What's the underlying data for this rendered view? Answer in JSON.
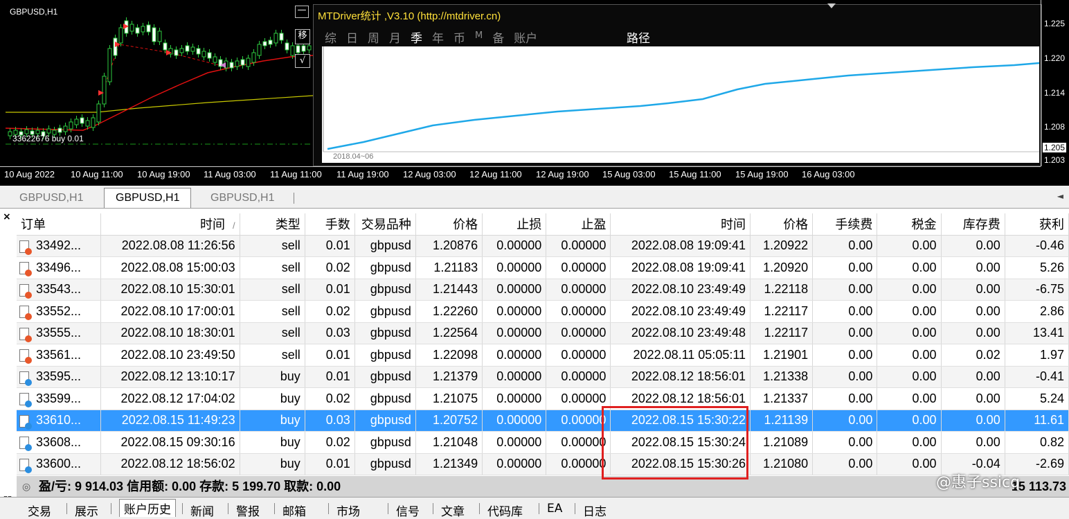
{
  "mini_chart": {
    "title": "GBPUSD,H1",
    "order_label": "33622676 buy 0.01",
    "move_button": "移",
    "check_button": "√",
    "minus_button": "—"
  },
  "panel": {
    "title": "MTDriver统计 ,V3.10 (http://mtdriver.cn)",
    "tabs": [
      "综",
      "日",
      "周",
      "月",
      "季",
      "年",
      "币",
      "M",
      "备",
      "账户"
    ],
    "active_tab": "季",
    "route_tab": "路径",
    "start_date": "2018.04~06",
    "line_color": "#1fa8e8"
  },
  "price_axis": [
    "1.225",
    "1.220",
    "1.214",
    "1.208",
    "1.205",
    "1.203"
  ],
  "time_axis": [
    "10 Aug 2022",
    "10 Aug 11:00",
    "10 Aug 19:00",
    "11 Aug 03:00",
    "11 Aug 11:00",
    "11 Aug 19:00",
    "12 Aug 03:00",
    "12 Aug 11:00",
    "12 Aug 19:00",
    "15 Aug 03:00",
    "15 Aug 11:00",
    "15 Aug 19:00",
    "16 Aug 03:00"
  ],
  "chart_tabs": [
    "GBPUSD,H1",
    "GBPUSD,H1",
    "GBPUSD,H1"
  ],
  "chart_tab_scroll": "◄",
  "close_icon": "×",
  "table": {
    "headers": [
      "订单",
      "时间",
      "类型",
      "手数",
      "交易品种",
      "价格",
      "止损",
      "止盈",
      "时间",
      "价格",
      "手续费",
      "税金",
      "库存费",
      "获利"
    ],
    "sort_marker": "/",
    "rows": [
      {
        "icon": "sell",
        "order": "33492...",
        "open_time": "2022.08.08 11:26:56",
        "type": "sell",
        "lots": "0.01",
        "symbol": "gbpusd",
        "open_price": "1.20876",
        "sl": "0.00000",
        "tp": "0.00000",
        "close_time": "2022.08.08 19:09:41",
        "close_price": "1.20922",
        "commission": "0.00",
        "taxes": "0.00",
        "swap": "0.00",
        "profit": "-0.46"
      },
      {
        "icon": "sell",
        "order": "33496...",
        "open_time": "2022.08.08 15:00:03",
        "type": "sell",
        "lots": "0.02",
        "symbol": "gbpusd",
        "open_price": "1.21183",
        "sl": "0.00000",
        "tp": "0.00000",
        "close_time": "2022.08.08 19:09:41",
        "close_price": "1.20920",
        "commission": "0.00",
        "taxes": "0.00",
        "swap": "0.00",
        "profit": "5.26"
      },
      {
        "icon": "sell",
        "order": "33543...",
        "open_time": "2022.08.10 15:30:01",
        "type": "sell",
        "lots": "0.01",
        "symbol": "gbpusd",
        "open_price": "1.21443",
        "sl": "0.00000",
        "tp": "0.00000",
        "close_time": "2022.08.10 23:49:49",
        "close_price": "1.22118",
        "commission": "0.00",
        "taxes": "0.00",
        "swap": "0.00",
        "profit": "-6.75"
      },
      {
        "icon": "sell",
        "order": "33552...",
        "open_time": "2022.08.10 17:00:01",
        "type": "sell",
        "lots": "0.02",
        "symbol": "gbpusd",
        "open_price": "1.22260",
        "sl": "0.00000",
        "tp": "0.00000",
        "close_time": "2022.08.10 23:49:49",
        "close_price": "1.22117",
        "commission": "0.00",
        "taxes": "0.00",
        "swap": "0.00",
        "profit": "2.86"
      },
      {
        "icon": "sell",
        "order": "33555...",
        "open_time": "2022.08.10 18:30:01",
        "type": "sell",
        "lots": "0.03",
        "symbol": "gbpusd",
        "open_price": "1.22564",
        "sl": "0.00000",
        "tp": "0.00000",
        "close_time": "2022.08.10 23:49:48",
        "close_price": "1.22117",
        "commission": "0.00",
        "taxes": "0.00",
        "swap": "0.00",
        "profit": "13.41"
      },
      {
        "icon": "sell",
        "order": "33561...",
        "open_time": "2022.08.10 23:49:50",
        "type": "sell",
        "lots": "0.01",
        "symbol": "gbpusd",
        "open_price": "1.22098",
        "sl": "0.00000",
        "tp": "0.00000",
        "close_time": "2022.08.11 05:05:11",
        "close_price": "1.21901",
        "commission": "0.00",
        "taxes": "0.00",
        "swap": "0.02",
        "profit": "1.97"
      },
      {
        "icon": "buy",
        "order": "33595...",
        "open_time": "2022.08.12 13:10:17",
        "type": "buy",
        "lots": "0.01",
        "symbol": "gbpusd",
        "open_price": "1.21379",
        "sl": "0.00000",
        "tp": "0.00000",
        "close_time": "2022.08.12 18:56:01",
        "close_price": "1.21338",
        "commission": "0.00",
        "taxes": "0.00",
        "swap": "0.00",
        "profit": "-0.41"
      },
      {
        "icon": "buy",
        "order": "33599...",
        "open_time": "2022.08.12 17:04:02",
        "type": "buy",
        "lots": "0.02",
        "symbol": "gbpusd",
        "open_price": "1.21075",
        "sl": "0.00000",
        "tp": "0.00000",
        "close_time": "2022.08.12 18:56:01",
        "close_price": "1.21337",
        "commission": "0.00",
        "taxes": "0.00",
        "swap": "0.00",
        "profit": "5.24"
      },
      {
        "icon": "buy",
        "order": "33610...",
        "open_time": "2022.08.15 11:49:23",
        "type": "buy",
        "lots": "0.03",
        "symbol": "gbpusd",
        "open_price": "1.20752",
        "sl": "0.00000",
        "tp": "0.00000",
        "close_time": "2022.08.15 15:30:22",
        "close_price": "1.21139",
        "commission": "0.00",
        "taxes": "0.00",
        "swap": "0.00",
        "profit": "11.61",
        "selected": true
      },
      {
        "icon": "buy",
        "order": "33608...",
        "open_time": "2022.08.15 09:30:16",
        "type": "buy",
        "lots": "0.02",
        "symbol": "gbpusd",
        "open_price": "1.21048",
        "sl": "0.00000",
        "tp": "0.00000",
        "close_time": "2022.08.15 15:30:24",
        "close_price": "1.21089",
        "commission": "0.00",
        "taxes": "0.00",
        "swap": "0.00",
        "profit": "0.82"
      },
      {
        "icon": "buy",
        "order": "33600...",
        "open_time": "2022.08.12 18:56:02",
        "type": "buy",
        "lots": "0.01",
        "symbol": "gbpusd",
        "open_price": "1.21349",
        "sl": "0.00000",
        "tp": "0.00000",
        "close_time": "2022.08.15 15:30:26",
        "close_price": "1.21080",
        "commission": "0.00",
        "taxes": "0.00",
        "swap": "-0.04",
        "profit": "-2.69"
      }
    ]
  },
  "summary": {
    "icon": "◎",
    "text": "盈/亏: 9 914.03  信用额: 0.00  存款: 5 199.70  取款: 0.00",
    "right_value": "15 113.73"
  },
  "watermark": "@惠子ssicq",
  "bottom_tabs": [
    "交易",
    "展示",
    "账户历史",
    "新闻",
    "警报",
    "邮箱",
    "市场",
    "信号",
    "文章",
    "代码库",
    "EA",
    "日志"
  ],
  "bottom_active": "账户历史",
  "side_label": "器"
}
